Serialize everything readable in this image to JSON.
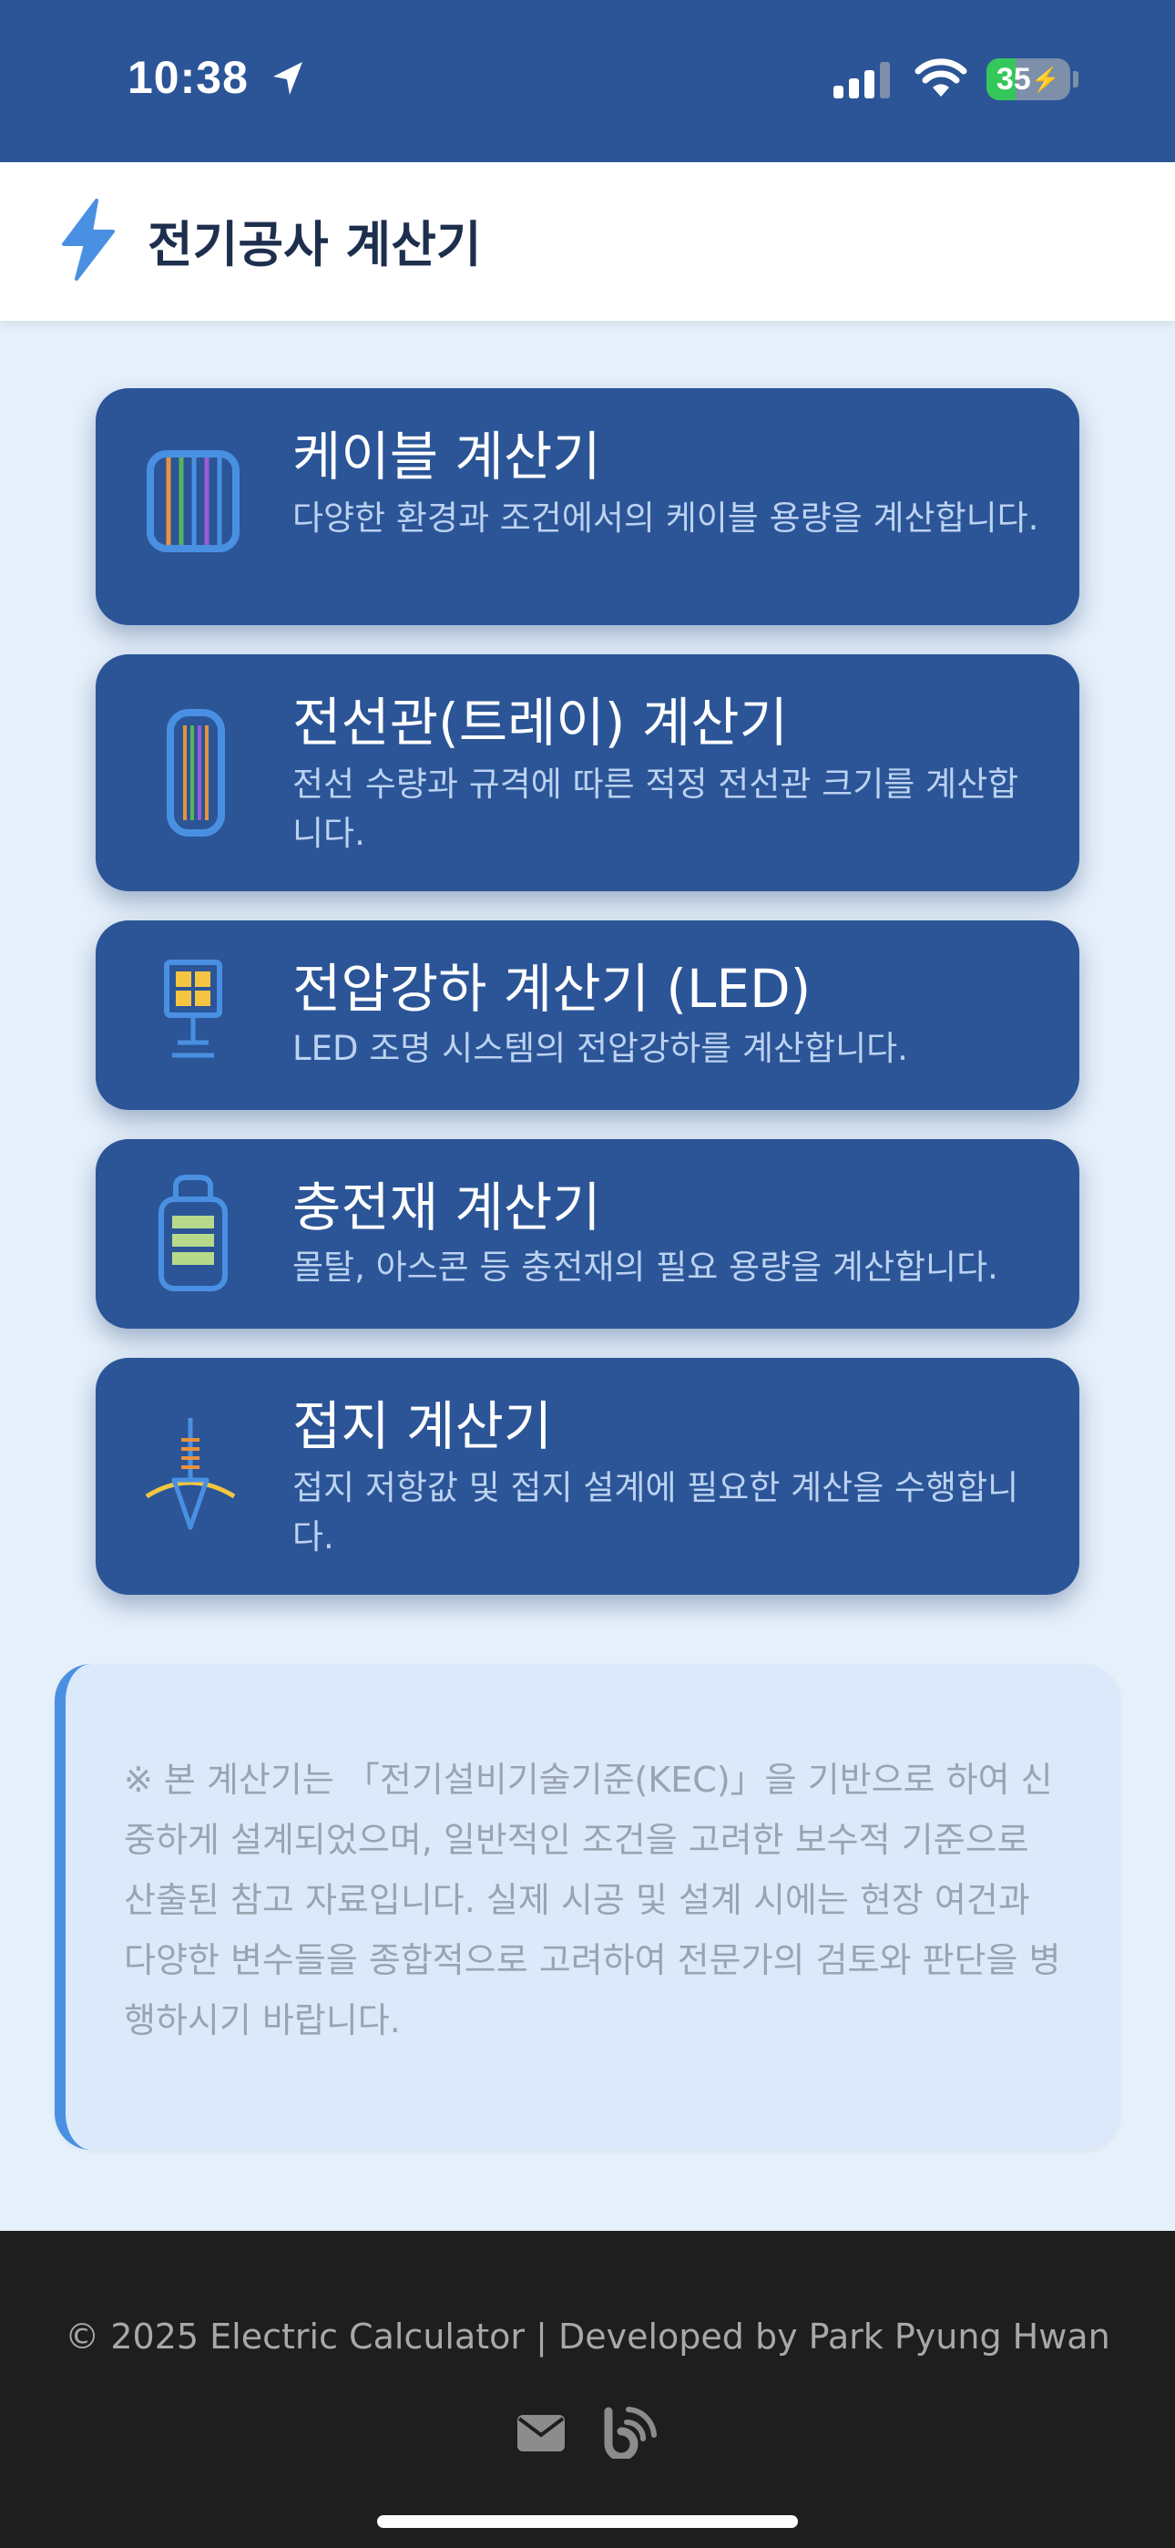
{
  "status_bar": {
    "time": "10:38",
    "battery_level": "35",
    "battery_fraction": 0.35,
    "icons": [
      "location-arrow-icon",
      "cellular-signal-icon",
      "wifi-icon",
      "battery-charging-icon"
    ]
  },
  "app_bar": {
    "title": "전기공사 계산기",
    "icon": "lightning-bolt-icon",
    "accent_color": "#4a90e2"
  },
  "calculators": [
    {
      "title": "케이블 계산기",
      "description": "다양한 환경과 조건에서의 케이블 용량을 계산합니다.",
      "icon": "cable-bundle-icon"
    },
    {
      "title": "전선관(트레이) 계산기",
      "description": "전선 수량과 규격에 따른 적정 전선관 크기를 계산합니다.",
      "icon": "conduit-icon"
    },
    {
      "title": "전압강하 계산기 (LED)",
      "description": "LED 조명 시스템의 전압강하를 계산합니다.",
      "icon": "led-panel-icon"
    },
    {
      "title": "충전재 계산기",
      "description": "몰탈, 아스콘 등 충전재의 필요 용량을 계산합니다.",
      "icon": "filler-bag-icon"
    },
    {
      "title": "접지 계산기",
      "description": "접지 저항값 및 접지 설계에 필요한 계산을 수행합니다.",
      "icon": "grounding-rod-icon"
    }
  ],
  "notice": {
    "text": "※ 본 계산기는 「전기설비기술기준(KEC)」을 기반으로 하여 신중하게 설계되었으며, 일반적인 조건을 고려한 보수적 기준으로 산출된 참고 자료입니다. 실제 시공 및 설계 시에는 현장 여건과 다양한 변수들을 종합적으로 고려하여 전문가의 검토와 판단을 병행하시기 바랍니다."
  },
  "footer": {
    "copyright": "© 2025 Electric Calculator  |  Developed by Park Pyung Hwan",
    "links": [
      "mail-icon",
      "blog-icon"
    ]
  },
  "colors": {
    "primary": "#2b5597",
    "background": "#e6f0fb",
    "footer": "#1e1e1e"
  }
}
